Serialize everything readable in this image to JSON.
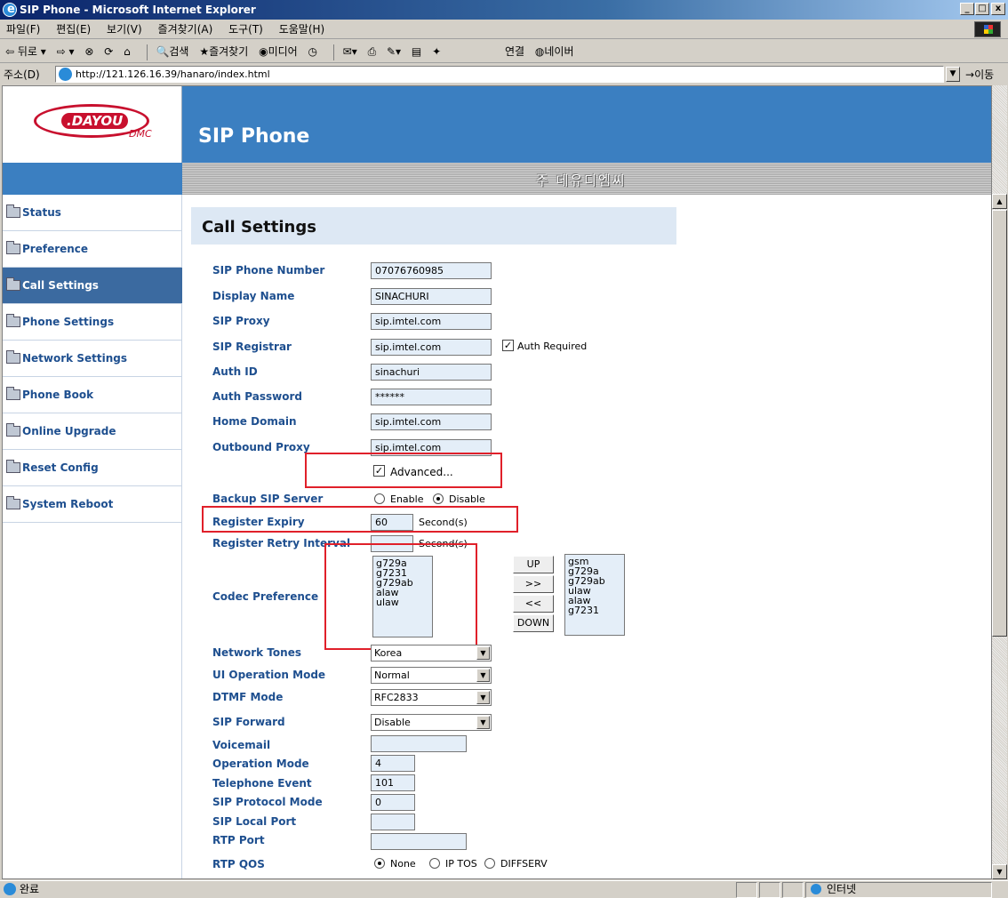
{
  "window": {
    "title": "SIP Phone - Microsoft Internet Explorer",
    "controls": [
      "_",
      "□",
      "x"
    ]
  },
  "menu": [
    "파일(F)",
    "편집(E)",
    "보기(V)",
    "즐겨찾기(A)",
    "도구(T)",
    "도움말(H)"
  ],
  "toolbar": {
    "back": "뒤로",
    "search": "검색",
    "favorites": "즐겨찾기",
    "media": "미디어",
    "links": "연결",
    "naver": "네이버"
  },
  "address": {
    "label": "주소(D)",
    "url": "http://121.126.16.39/hanaro/index.html",
    "go": "이동"
  },
  "header": {
    "logo_text": ".DAYOU",
    "logo_sub": "DMC",
    "app_title": "SIP Phone",
    "company": "주 데유디엠씨"
  },
  "sidebar": {
    "items": [
      "Status",
      "Preference",
      "Call Settings",
      "Phone Settings",
      "Network Settings",
      "Phone Book",
      "Online Upgrade",
      "Reset Config",
      "System Reboot"
    ],
    "active": "Call Settings"
  },
  "form": {
    "title": "Call Settings",
    "sip_phone_number": {
      "label": "SIP Phone Number",
      "value": "07076760985"
    },
    "display_name": {
      "label": "Display Name",
      "value": "SINACHURI"
    },
    "sip_proxy": {
      "label": "SIP Proxy",
      "value": "sip.imtel.com"
    },
    "sip_registrar": {
      "label": "SIP Registrar",
      "value": "sip.imtel.com",
      "auth_required": "Auth Required"
    },
    "auth_id": {
      "label": "Auth ID",
      "value": "sinachuri"
    },
    "auth_password": {
      "label": "Auth Password",
      "value": "******"
    },
    "home_domain": {
      "label": "Home Domain",
      "value": "sip.imtel.com"
    },
    "outbound_proxy": {
      "label": "Outbound Proxy",
      "value": "sip.imtel.com"
    },
    "advanced": "Advanced...",
    "backup_sip_server": {
      "label": "Backup SIP Server",
      "enable": "Enable",
      "disable": "Disable",
      "selected": "Disable"
    },
    "register_expiry": {
      "label": "Register Expiry",
      "value": "60",
      "unit": "Second(s)"
    },
    "register_retry": {
      "label": "Register Retry Interval",
      "value": "",
      "unit": "Second(s)"
    },
    "codec_preference": {
      "label": "Codec Preference",
      "left": [
        "g729a",
        "g7231",
        "g729ab",
        "alaw",
        "ulaw"
      ],
      "right": [
        "gsm",
        "g729a",
        "g729ab",
        "ulaw",
        "alaw",
        "g7231"
      ],
      "btn_up": "UP",
      "btn_add": ">>",
      "btn_remove": "<<",
      "btn_down": "DOWN"
    },
    "network_tones": {
      "label": "Network Tones",
      "value": "Korea"
    },
    "ui_operation_mode": {
      "label": "UI Operation Mode",
      "value": "Normal"
    },
    "dtmf_mode": {
      "label": "DTMF Mode",
      "value": "RFC2833"
    },
    "sip_forward": {
      "label": "SIP Forward",
      "value": "Disable"
    },
    "voicemail": {
      "label": "Voicemail",
      "value": ""
    },
    "operation_mode": {
      "label": "Operation Mode",
      "value": "4"
    },
    "telephone_event": {
      "label": "Telephone Event",
      "value": "101"
    },
    "sip_protocol_mode": {
      "label": "SIP Protocol Mode",
      "value": "0"
    },
    "sip_local_port": {
      "label": "SIP Local Port",
      "value": ""
    },
    "rtp_port": {
      "label": "RTP Port",
      "value": ""
    },
    "rtp_qos": {
      "label": "RTP QOS",
      "none": "None",
      "iptos": "IP TOS",
      "diffserv": "DIFFSERV",
      "selected": "None"
    }
  },
  "status": {
    "text": "완료",
    "zone": "인터넷"
  },
  "colors": {
    "header_blue": "#3b7fc1",
    "nav_text": "#1e4f8f",
    "highlight_red": "#e0202a",
    "input_bg": "#e4eef8"
  }
}
